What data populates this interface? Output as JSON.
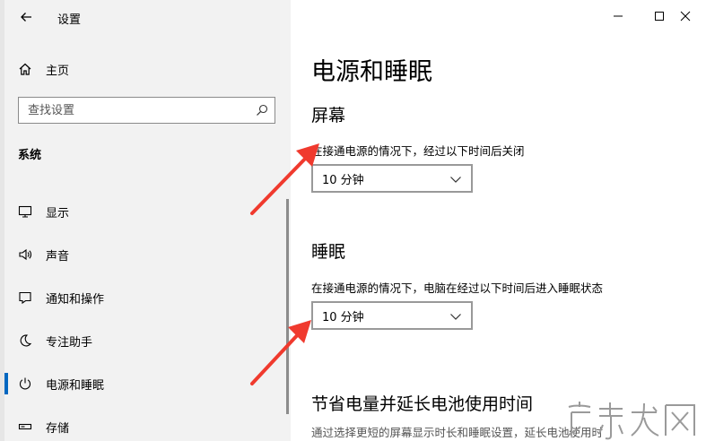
{
  "window": {
    "title": "设置",
    "controls": {
      "minimize": "minimize",
      "maximize": "maximize",
      "close": "close"
    }
  },
  "sidebar": {
    "home_label": "主页",
    "search_placeholder": "查找设置",
    "section_title": "系统",
    "items": [
      {
        "label": "显示",
        "icon": "monitor-icon",
        "selected": false
      },
      {
        "label": "声音",
        "icon": "speaker-icon",
        "selected": false
      },
      {
        "label": "通知和操作",
        "icon": "notification-icon",
        "selected": false
      },
      {
        "label": "专注助手",
        "icon": "moon-icon",
        "selected": false
      },
      {
        "label": "电源和睡眠",
        "icon": "power-icon",
        "selected": true
      },
      {
        "label": "存储",
        "icon": "storage-icon",
        "selected": false
      }
    ]
  },
  "main": {
    "page_title": "电源和睡眠",
    "screen": {
      "title": "屏幕",
      "label": "在接通电源的情况下，经过以下时间后关闭",
      "value": "10 分钟"
    },
    "sleep": {
      "title": "睡眠",
      "label": "在接通电源的情况下，电脑在经过以下时间后进入睡眠状态",
      "value": "10 分钟"
    },
    "battery": {
      "title": "节省电量并延长电池使用时间",
      "desc": "通过选择更短的屏幕显示时长和睡眠设置，延长电池使用时"
    }
  },
  "colors": {
    "accent": "#0067c0",
    "annotation_arrow": "#f03a2e",
    "watermark": "#9a9a9a"
  }
}
